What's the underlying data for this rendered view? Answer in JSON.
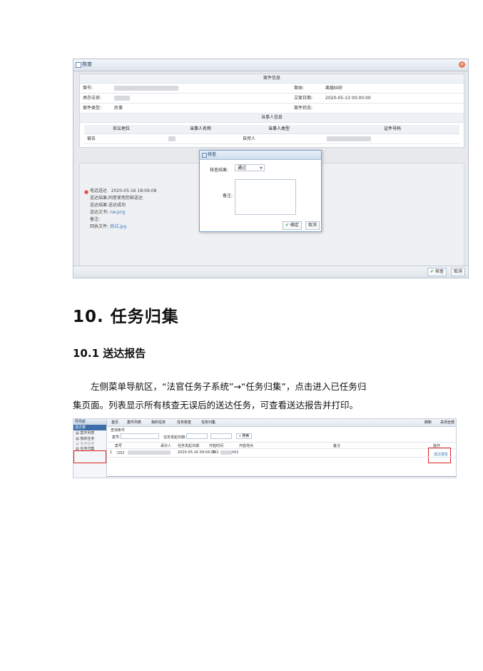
{
  "screenshot1": {
    "window_title": "核查",
    "section_case": "案件信息",
    "case_number_label": "案号:",
    "cause_label": "案由:",
    "cause_value": "离婚纠纷",
    "judge_label": "承办法官:",
    "filing_date_label": "立案日期:",
    "filing_date_value": "2020-05-13 00:00:00",
    "case_type_label": "案件类型:",
    "case_type_value": "民事",
    "case_status_label": "案件状态:",
    "section_party": "当事人信息",
    "party_headers": [
      "诉讼地位",
      "当事人名称",
      "当事人类型",
      "证件号码"
    ],
    "party_row": {
      "role": "被告",
      "type": "自然人"
    },
    "log": {
      "method": "电话送达",
      "time": "2020-05-16 18:09:08",
      "line1": "送达结果:同意使用您邮送达",
      "line2": "送达结果:送达成功",
      "line3_label": "送达文书:",
      "line3_link": "nw.png",
      "line4": "备注:",
      "line5_label": "回执文件:",
      "line5_link": "测试.jpg"
    },
    "dialog": {
      "title": "核查",
      "result_label": "核查结果:",
      "result_value": "通过",
      "remark_label": "备注:",
      "ok": "确定",
      "cancel": "取消"
    },
    "footer_ok": "核查",
    "footer_cancel": "取消"
  },
  "heading1": "10.  任务归集",
  "heading2": "10.1  送达报告",
  "paragraph_line1": "左侧菜单导航区，“法官任务子系统”→“任务归集”，点击进入已任务归",
  "paragraph_line2": "集页面。列表显示所有核查无误后的送达任务，可查看送达报告并打印。",
  "screenshot2": {
    "nav_title": "导导航",
    "nav_sub": "送达菜",
    "nav_items": [
      "案件列表",
      "我的任务",
      "任务任务",
      "任务归集"
    ],
    "tabs": [
      "首页",
      "案件列表",
      "我的任务",
      "任务核查",
      "任务归集"
    ],
    "top_right": [
      "刷新",
      "关闭全部"
    ],
    "query_title": "查询条件",
    "case_no_label": "案号:",
    "date_label": "任务发起日期:",
    "search_btn": "搜索",
    "columns": [
      "案号",
      "承办人",
      "任务发起日期",
      "开庭时间",
      "开庭地点",
      "备注",
      "操作"
    ],
    "row_index": "1",
    "row_case": "（202",
    "row_date": "2020-05-16 09:04:05",
    "row_time": "202",
    "row_place": "h01",
    "row_action": "送达报告"
  }
}
